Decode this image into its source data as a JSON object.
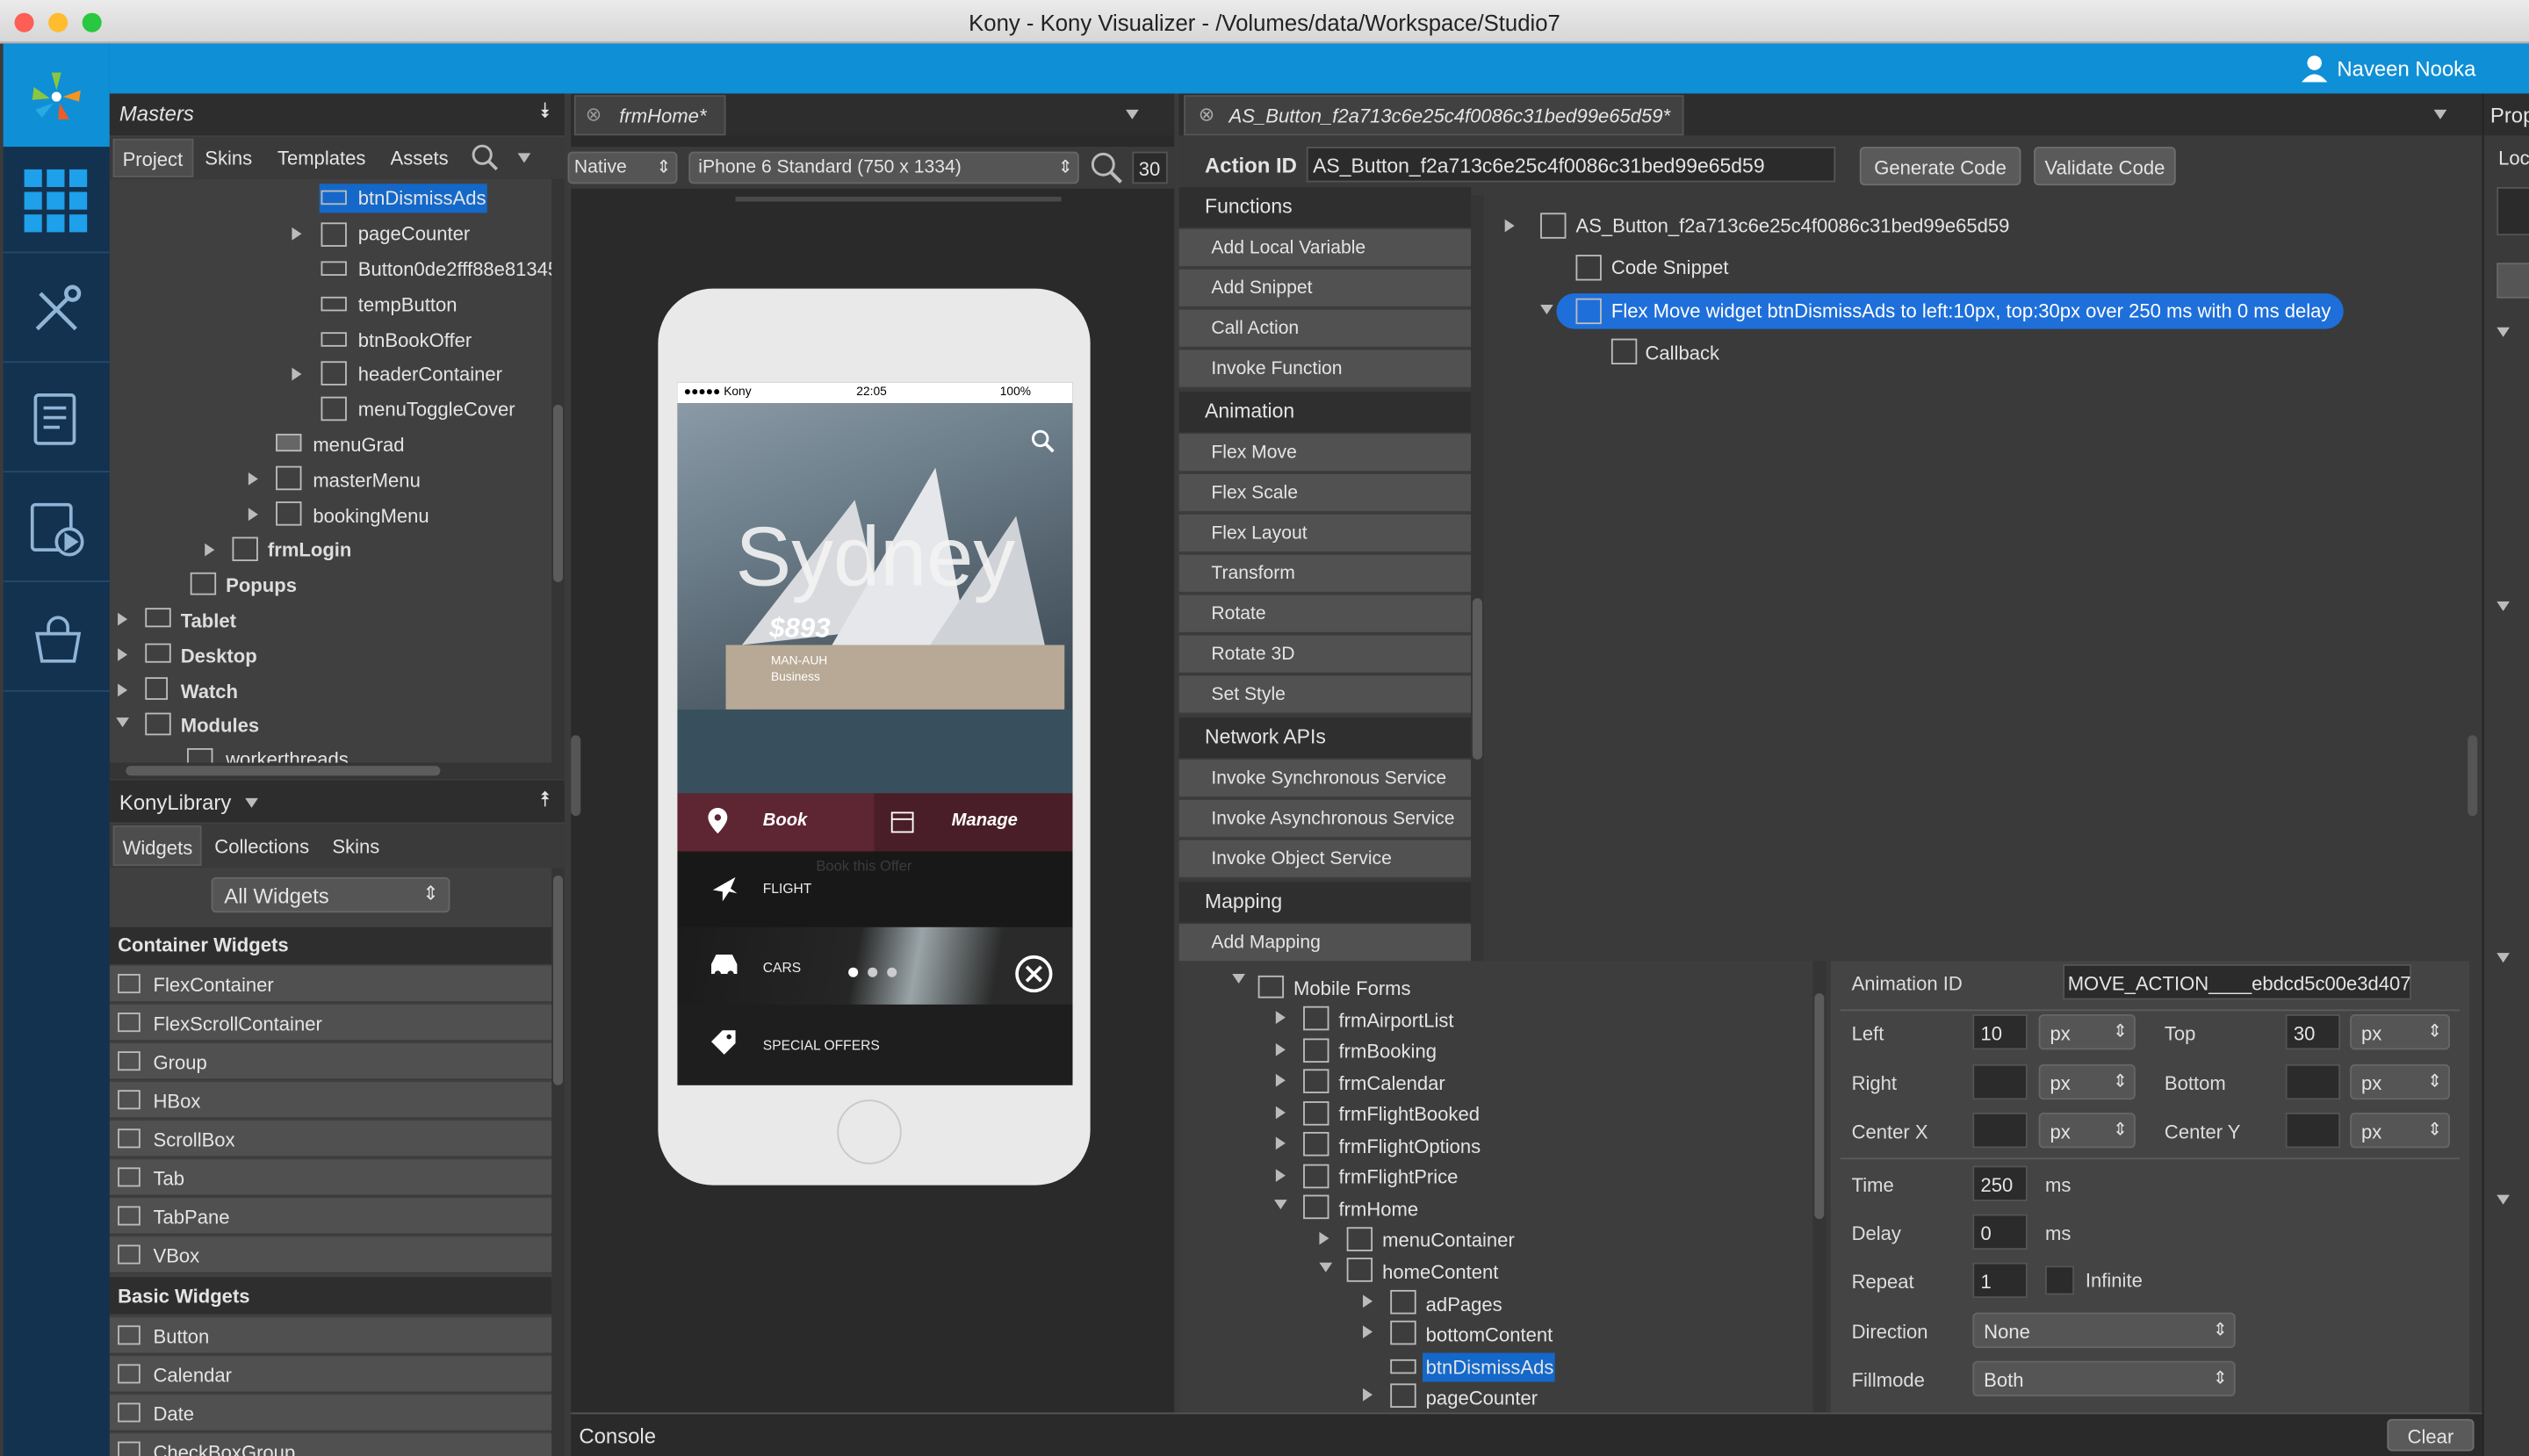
{
  "window": {
    "title": "Kony - Kony Visualizer - /Volumes/data/Workspace/Studio7",
    "user": "Naveen Nooka"
  },
  "masters": {
    "title": "Masters",
    "tabs": [
      "Project",
      "Skins",
      "Templates",
      "Assets"
    ],
    "tree": [
      "btnDismissAds",
      "pageCounter",
      "Button0de2fff88e81345",
      "tempButton",
      "btnBookOffer",
      "headerContainer",
      "menuToggleCover",
      "menuGrad",
      "masterMenu",
      "bookingMenu",
      "frmLogin",
      "Popups",
      "Tablet",
      "Desktop",
      "Watch",
      "Modules",
      "workerthreads"
    ]
  },
  "library": {
    "title": "KonyLibrary",
    "tabs": [
      "Widgets",
      "Collections",
      "Skins"
    ],
    "filter": "All Widgets",
    "container_header": "Container Widgets",
    "container": [
      "FlexContainer",
      "FlexScrollContainer",
      "Group",
      "HBox",
      "ScrollBox",
      "Tab",
      "TabPane",
      "VBox"
    ],
    "basic_header": "Basic Widgets",
    "basic": [
      "Button",
      "Calendar",
      "Date",
      "CheckBoxGroup"
    ]
  },
  "form": {
    "tab": "frmHome*",
    "platform": "Native",
    "device": "iPhone 6 Standard (750 x 1334)",
    "zoom": "30",
    "phone": {
      "carrier": "●●●●● Kony",
      "time": "22:05",
      "battery": "100%",
      "city": "Sydney",
      "price": "$893",
      "route": "MAN-AUH",
      "cls": "Business",
      "book": "Book",
      "manage": "Manage",
      "flight": "FLIGHT",
      "cars": "CARS",
      "offers": "SPECIAL OFFERS",
      "ghost": "Book this Offer"
    }
  },
  "action": {
    "tab": "AS_Button_f2a713c6e25c4f0086c31bed99e65d59*",
    "id_label": "Action ID",
    "id": "AS_Button_f2a713c6e25c4f0086c31bed99e65d59",
    "generate": "Generate Code",
    "validate": "Validate Code",
    "groups": [
      {
        "h": "Functions",
        "items": [
          "Add Local Variable",
          "Add Snippet",
          "Call Action",
          "Invoke Function"
        ]
      },
      {
        "h": "Animation",
        "items": [
          "Flex Move",
          "Flex Scale",
          "Flex Layout",
          "Transform",
          "Rotate",
          "Rotate 3D",
          "Set Style"
        ]
      },
      {
        "h": "Network APIs",
        "items": [
          "Invoke Synchronous Service",
          "Invoke Asynchronous Service",
          "Invoke Object Service"
        ]
      },
      {
        "h": "Mapping",
        "items": [
          "Add Mapping"
        ]
      }
    ],
    "seq": [
      "AS_Button_f2a713c6e25c4f0086c31bed99e65d59",
      "Code Snippet",
      "Flex Move widget btnDismissAds to left:10px, top:30px over 250 ms with 0 ms delay",
      "Callback"
    ]
  },
  "forms_tree": [
    "Mobile Forms",
    "frmAirportList",
    "frmBooking",
    "frmCalendar",
    "frmFlightBooked",
    "frmFlightOptions",
    "frmFlightPrice",
    "frmHome",
    "menuContainer",
    "homeContent",
    "adPages",
    "bottomContent",
    "btnDismissAds",
    "pageCounter"
  ],
  "anim": {
    "id_label": "Animation ID",
    "id": "MOVE_ACTION____ebdcd5c00e3d407",
    "left_label": "Left",
    "left": "10",
    "top_label": "Top",
    "top": "30",
    "right_label": "Right",
    "bottom_label": "Bottom",
    "cx_label": "Center X",
    "cy_label": "Center Y",
    "unit": "px",
    "time_label": "Time",
    "time": "250",
    "delay_label": "Delay",
    "delay": "0",
    "ms": "ms",
    "repeat_label": "Repeat",
    "repeat": "1",
    "infinite": "Infinite",
    "direction_label": "Direction",
    "direction": "None",
    "fill_label": "Fillmode",
    "fill": "Both"
  },
  "console": {
    "title": "Console",
    "clear": "Clear"
  },
  "props": {
    "title": "Prop",
    "sub": "Loc"
  }
}
